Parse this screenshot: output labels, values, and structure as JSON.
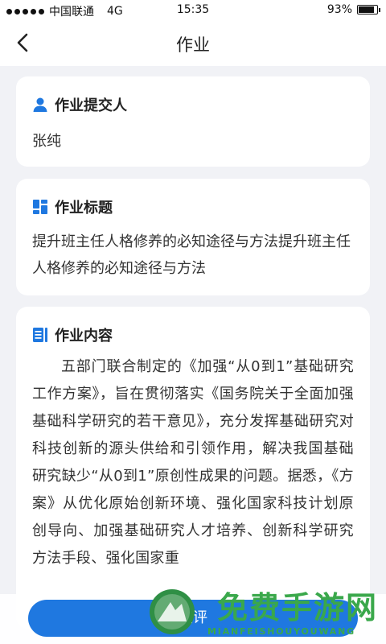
{
  "status_bar": {
    "carrier": "中国联通",
    "network": "4G",
    "time": "15:35",
    "battery_text": "93%",
    "battery_level": 0.93
  },
  "nav": {
    "title": "作业",
    "back_icon": "chevron-left-icon"
  },
  "submitter": {
    "heading": "作业提交人",
    "icon": "person-icon",
    "value": "张纯"
  },
  "homework_title": {
    "heading": "作业标题",
    "icon": "grid-icon",
    "value": "提升班主任人格修养的必知途径与方法提升班主任人格修养的必知途径与方法"
  },
  "homework_content": {
    "heading": "作业内容",
    "icon": "document-icon",
    "value": "五部门联合制定的《加强“从0到1”基础研究工作方案》，旨在贯彻落实《国务院关于全面加强基础科学研究的若干意见》，充分发挥基础研究对科技创新的源头供给和引领作用，解决我国基础研究缺少“从0到1”原创性成果的问题。据悉，《方案》从优化原始创新环境、强化国家科技计划原创导向、加强基础研究人才培养、创新科学研究方法手段、强化国家重"
  },
  "bottom": {
    "comment_button": "点评"
  },
  "watermark": {
    "title": "免费手游网",
    "subtitle": "MIANFEISHOUYOUWANG"
  },
  "colors": {
    "accent": "#1f78e0",
    "watermark": "#3aa84b",
    "background": "#f1f2f6"
  }
}
